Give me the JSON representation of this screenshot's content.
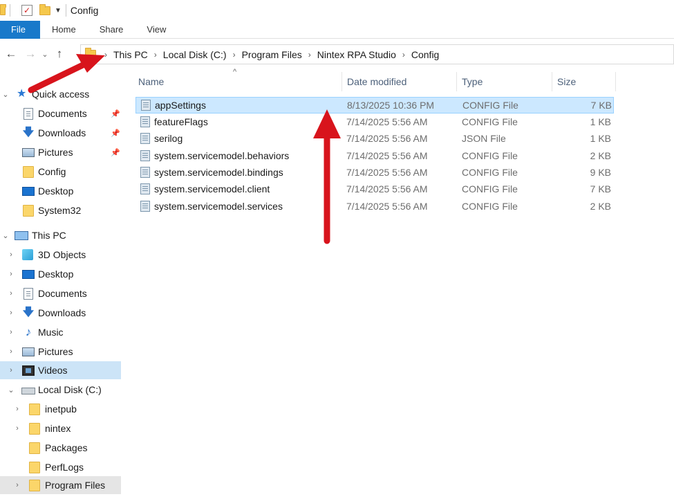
{
  "window": {
    "title": "Config"
  },
  "ribbon": {
    "tabs": [
      "File",
      "Home",
      "Share",
      "View"
    ]
  },
  "address": {
    "crumbs": [
      "This PC",
      "Local Disk (C:)",
      "Program Files",
      "Nintex RPA Studio",
      "Config"
    ]
  },
  "nav": {
    "quick_access": {
      "label": "Quick access",
      "items": [
        {
          "label": "Documents",
          "icon": "documents-icon",
          "pinned": true
        },
        {
          "label": "Downloads",
          "icon": "downloads-icon",
          "pinned": true
        },
        {
          "label": "Pictures",
          "icon": "pictures-icon",
          "pinned": true
        },
        {
          "label": "Config",
          "icon": "folder-icon",
          "pinned": false
        },
        {
          "label": "Desktop",
          "icon": "desktop-icon",
          "pinned": false
        },
        {
          "label": "System32",
          "icon": "folder-icon",
          "pinned": false
        }
      ]
    },
    "this_pc": {
      "label": "This PC",
      "items": [
        {
          "label": "3D Objects",
          "icon": "3d-objects-icon"
        },
        {
          "label": "Desktop",
          "icon": "desktop-icon"
        },
        {
          "label": "Documents",
          "icon": "documents-icon"
        },
        {
          "label": "Downloads",
          "icon": "downloads-icon"
        },
        {
          "label": "Music",
          "icon": "music-icon"
        },
        {
          "label": "Pictures",
          "icon": "pictures-icon"
        },
        {
          "label": "Videos",
          "icon": "videos-icon"
        }
      ]
    },
    "local_disk": {
      "label": "Local Disk (C:)",
      "items": [
        {
          "label": "inetpub",
          "icon": "folder-icon"
        },
        {
          "label": "nintex",
          "icon": "folder-icon"
        },
        {
          "label": "Packages",
          "icon": "folder-icon"
        },
        {
          "label": "PerfLogs",
          "icon": "folder-icon"
        },
        {
          "label": "Program Files",
          "icon": "folder-icon"
        }
      ]
    }
  },
  "columns": {
    "name": "Name",
    "date": "Date modified",
    "type": "Type",
    "size": "Size"
  },
  "files": [
    {
      "name": "appSettings",
      "date": "8/13/2025 10:36 PM",
      "type": "CONFIG File",
      "size": "7 KB",
      "selected": true
    },
    {
      "name": "featureFlags",
      "date": "7/14/2025 5:56 AM",
      "type": "CONFIG File",
      "size": "1 KB"
    },
    {
      "name": "serilog",
      "date": "7/14/2025 5:56 AM",
      "type": "JSON File",
      "size": "1 KB"
    },
    {
      "name": "system.servicemodel.behaviors",
      "date": "7/14/2025 5:56 AM",
      "type": "CONFIG File",
      "size": "2 KB"
    },
    {
      "name": "system.servicemodel.bindings",
      "date": "7/14/2025 5:56 AM",
      "type": "CONFIG File",
      "size": "9 KB"
    },
    {
      "name": "system.servicemodel.client",
      "date": "7/14/2025 5:56 AM",
      "type": "CONFIG File",
      "size": "7 KB"
    },
    {
      "name": "system.servicemodel.services",
      "date": "7/14/2025 5:56 AM",
      "type": "CONFIG File",
      "size": "2 KB"
    }
  ],
  "colors": {
    "accent": "#1979ca",
    "selection": "#cce8ff",
    "annotation": "#d8141c"
  }
}
